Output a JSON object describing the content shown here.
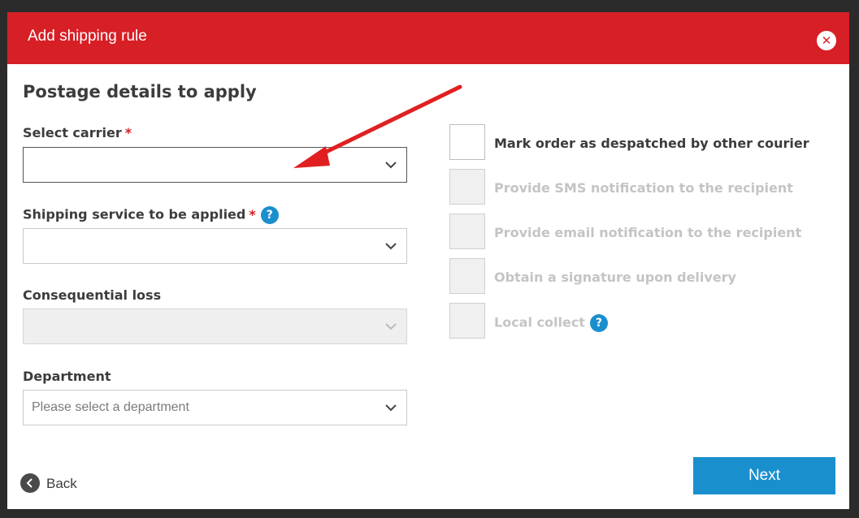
{
  "modal": {
    "title": "Add shipping rule",
    "close_icon": "close-icon",
    "section_title": "Postage details to apply"
  },
  "fields": {
    "carrier": {
      "label": "Select carrier",
      "required_mark": "*",
      "value": ""
    },
    "service": {
      "label": "Shipping service to be applied",
      "required_mark": "*",
      "help": "?",
      "value": ""
    },
    "consequential": {
      "label": "Consequential loss",
      "value": "",
      "disabled": true
    },
    "department": {
      "label": "Department",
      "placeholder": "Please select a department"
    }
  },
  "options": [
    {
      "label": "Mark order as despatched by other courier",
      "enabled": true
    },
    {
      "label": "Provide SMS notification to the recipient",
      "enabled": false
    },
    {
      "label": "Provide email notification to the recipient",
      "enabled": false
    },
    {
      "label": "Obtain a signature upon delivery",
      "enabled": false
    },
    {
      "label": "Local collect",
      "enabled": false,
      "help": "?"
    }
  ],
  "footer": {
    "back_label": "Back",
    "next_label": "Next"
  },
  "colors": {
    "header": "#d71f26",
    "primary": "#1a8fce",
    "annotation_arrow": "#e02020"
  }
}
